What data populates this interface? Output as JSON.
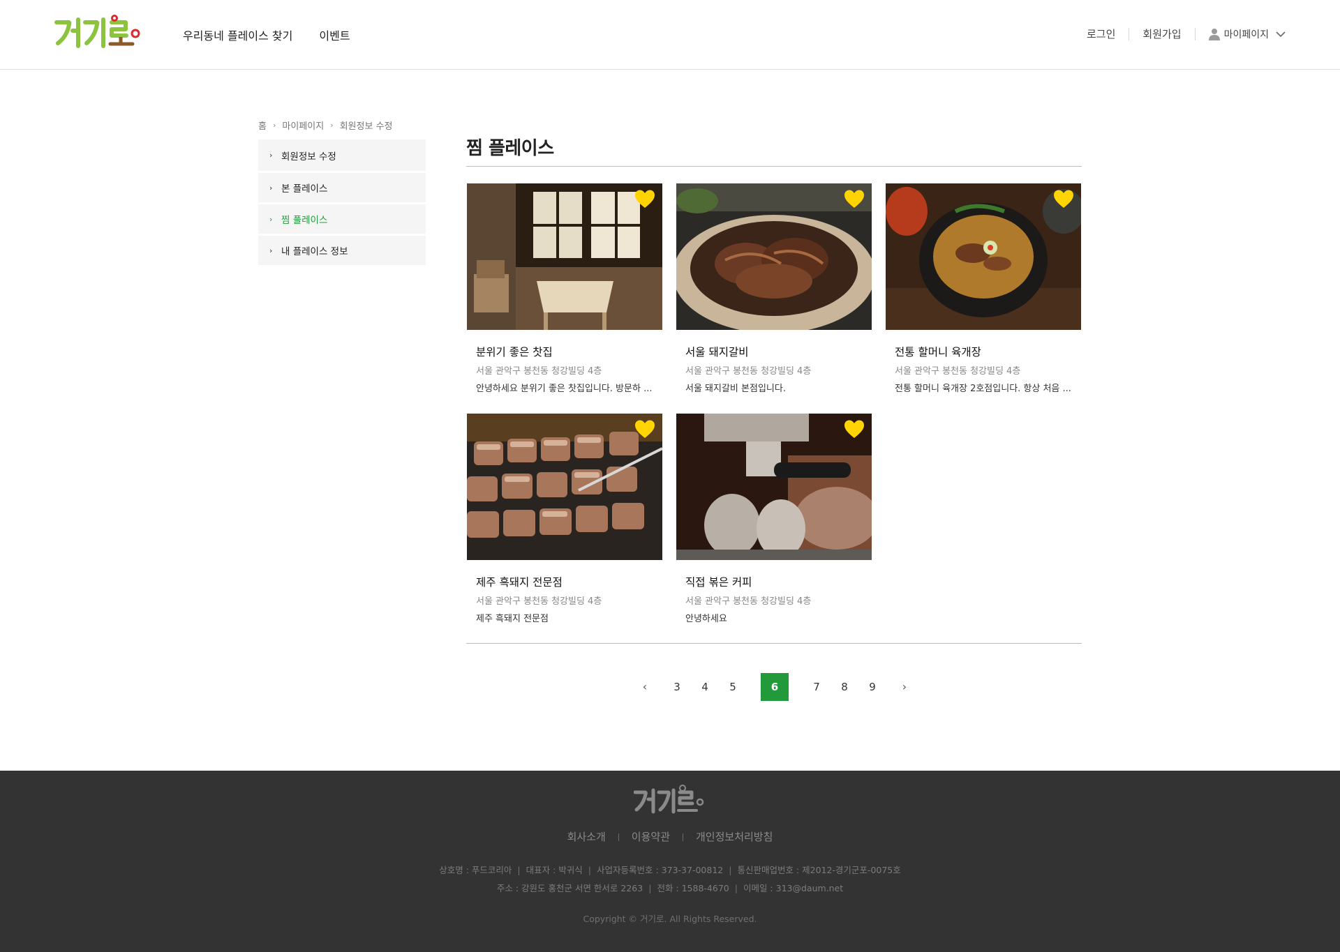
{
  "header": {
    "nav": [
      "우리동네 플레이스 찾기",
      "이벤트"
    ],
    "login": "로그인",
    "signup": "회원가입",
    "mypage": "마이페이지"
  },
  "breadcrumb": [
    "홈",
    "마이페이지",
    "회원정보 수정"
  ],
  "sidebar": {
    "items": [
      {
        "label": "회원정보 수정"
      },
      {
        "label": "본 플레이스"
      },
      {
        "label": "찜 플레이스",
        "active": true
      },
      {
        "label": "내 플레이스 정보"
      }
    ]
  },
  "main": {
    "title": "찜 플레이스",
    "cards": [
      {
        "name": "분위기 좋은 찻집",
        "address": "서울 관악구 봉천동 청강빌딩 4층",
        "desc": "안녕하세요 분위기 좋은 찻집입니다. 방문하 ...",
        "liked": true
      },
      {
        "name": "서울 돼지갈비",
        "address": "서울 관악구 봉천동 청강빌딩 4층",
        "desc": "서울 돼지갈비 본점입니다.",
        "liked": true
      },
      {
        "name": "전통 할머니 육개장",
        "address": "서울 관악구 봉천동 청강빌딩 4층",
        "desc": "전통 할머니 육개장 2호점입니다. 항상 처음 ...",
        "liked": true
      },
      {
        "name": "제주 흑돼지 전문점",
        "address": "서울 관악구 봉천동 청강빌딩 4층",
        "desc": "제주 흑돼지 전문점",
        "liked": true
      },
      {
        "name": "직접 볶은 커피",
        "address": "서울 관악구 봉천동 청강빌딩 4층",
        "desc": "안녕하세요",
        "liked": true
      }
    ]
  },
  "pagination": {
    "prev": "‹",
    "next": "›",
    "pages": [
      "3",
      "4",
      "5",
      "6",
      "7",
      "8",
      "9"
    ],
    "current": "6"
  },
  "footer": {
    "links": [
      "회사소개",
      "이용약관",
      "개인정보처리방침"
    ],
    "info_line1": [
      "상호명 : 푸드코리아",
      "대표자 : 박귀식",
      "사업자등록번호 : 373-37-00812",
      "통신판매업번호 : 제2012-경기군포-0075호"
    ],
    "info_line2": [
      "주소 : 강원도 홍천군 서면 한서로 2263",
      "전화 : 1588-4670",
      "이메일 : 313@daum.net"
    ],
    "copyright": "Copyright © 거기로. All Rights Reserved."
  },
  "colors": {
    "accent": "#229a3c",
    "heart": "#ffd400",
    "footer_bg": "#333333"
  }
}
